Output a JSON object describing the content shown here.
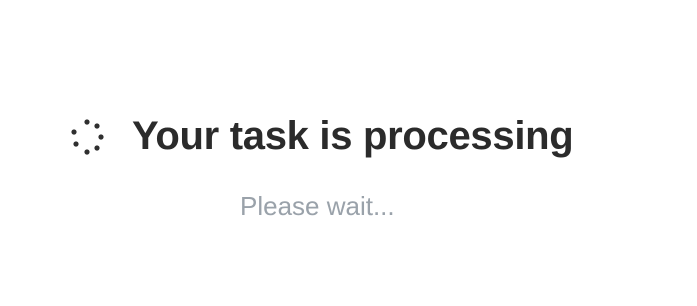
{
  "status": {
    "icon": "loading-spinner-icon",
    "title": "Your task is processing",
    "subtitle": "Please wait...",
    "colors": {
      "title": "#2b2b2b",
      "subtitle": "#9aa2aa",
      "spinner": "#2f2f2f",
      "background": "#ffffff"
    }
  }
}
